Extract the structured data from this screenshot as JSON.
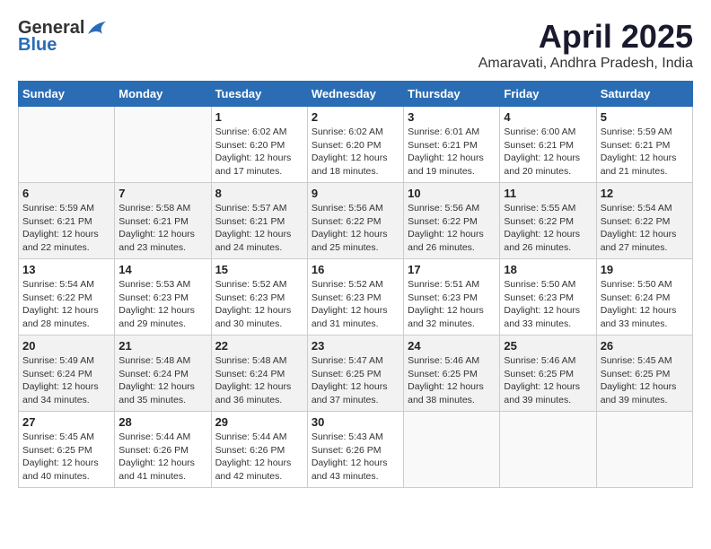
{
  "header": {
    "logo_general": "General",
    "logo_blue": "Blue",
    "title": "April 2025",
    "subtitle": "Amaravati, Andhra Pradesh, India"
  },
  "weekdays": [
    "Sunday",
    "Monday",
    "Tuesday",
    "Wednesday",
    "Thursday",
    "Friday",
    "Saturday"
  ],
  "weeks": [
    [
      {
        "day": "",
        "sunrise": "",
        "sunset": "",
        "daylight": ""
      },
      {
        "day": "",
        "sunrise": "",
        "sunset": "",
        "daylight": ""
      },
      {
        "day": "1",
        "sunrise": "Sunrise: 6:02 AM",
        "sunset": "Sunset: 6:20 PM",
        "daylight": "Daylight: 12 hours and 17 minutes."
      },
      {
        "day": "2",
        "sunrise": "Sunrise: 6:02 AM",
        "sunset": "Sunset: 6:20 PM",
        "daylight": "Daylight: 12 hours and 18 minutes."
      },
      {
        "day": "3",
        "sunrise": "Sunrise: 6:01 AM",
        "sunset": "Sunset: 6:21 PM",
        "daylight": "Daylight: 12 hours and 19 minutes."
      },
      {
        "day": "4",
        "sunrise": "Sunrise: 6:00 AM",
        "sunset": "Sunset: 6:21 PM",
        "daylight": "Daylight: 12 hours and 20 minutes."
      },
      {
        "day": "5",
        "sunrise": "Sunrise: 5:59 AM",
        "sunset": "Sunset: 6:21 PM",
        "daylight": "Daylight: 12 hours and 21 minutes."
      }
    ],
    [
      {
        "day": "6",
        "sunrise": "Sunrise: 5:59 AM",
        "sunset": "Sunset: 6:21 PM",
        "daylight": "Daylight: 12 hours and 22 minutes."
      },
      {
        "day": "7",
        "sunrise": "Sunrise: 5:58 AM",
        "sunset": "Sunset: 6:21 PM",
        "daylight": "Daylight: 12 hours and 23 minutes."
      },
      {
        "day": "8",
        "sunrise": "Sunrise: 5:57 AM",
        "sunset": "Sunset: 6:21 PM",
        "daylight": "Daylight: 12 hours and 24 minutes."
      },
      {
        "day": "9",
        "sunrise": "Sunrise: 5:56 AM",
        "sunset": "Sunset: 6:22 PM",
        "daylight": "Daylight: 12 hours and 25 minutes."
      },
      {
        "day": "10",
        "sunrise": "Sunrise: 5:56 AM",
        "sunset": "Sunset: 6:22 PM",
        "daylight": "Daylight: 12 hours and 26 minutes."
      },
      {
        "day": "11",
        "sunrise": "Sunrise: 5:55 AM",
        "sunset": "Sunset: 6:22 PM",
        "daylight": "Daylight: 12 hours and 26 minutes."
      },
      {
        "day": "12",
        "sunrise": "Sunrise: 5:54 AM",
        "sunset": "Sunset: 6:22 PM",
        "daylight": "Daylight: 12 hours and 27 minutes."
      }
    ],
    [
      {
        "day": "13",
        "sunrise": "Sunrise: 5:54 AM",
        "sunset": "Sunset: 6:22 PM",
        "daylight": "Daylight: 12 hours and 28 minutes."
      },
      {
        "day": "14",
        "sunrise": "Sunrise: 5:53 AM",
        "sunset": "Sunset: 6:23 PM",
        "daylight": "Daylight: 12 hours and 29 minutes."
      },
      {
        "day": "15",
        "sunrise": "Sunrise: 5:52 AM",
        "sunset": "Sunset: 6:23 PM",
        "daylight": "Daylight: 12 hours and 30 minutes."
      },
      {
        "day": "16",
        "sunrise": "Sunrise: 5:52 AM",
        "sunset": "Sunset: 6:23 PM",
        "daylight": "Daylight: 12 hours and 31 minutes."
      },
      {
        "day": "17",
        "sunrise": "Sunrise: 5:51 AM",
        "sunset": "Sunset: 6:23 PM",
        "daylight": "Daylight: 12 hours and 32 minutes."
      },
      {
        "day": "18",
        "sunrise": "Sunrise: 5:50 AM",
        "sunset": "Sunset: 6:23 PM",
        "daylight": "Daylight: 12 hours and 33 minutes."
      },
      {
        "day": "19",
        "sunrise": "Sunrise: 5:50 AM",
        "sunset": "Sunset: 6:24 PM",
        "daylight": "Daylight: 12 hours and 33 minutes."
      }
    ],
    [
      {
        "day": "20",
        "sunrise": "Sunrise: 5:49 AM",
        "sunset": "Sunset: 6:24 PM",
        "daylight": "Daylight: 12 hours and 34 minutes."
      },
      {
        "day": "21",
        "sunrise": "Sunrise: 5:48 AM",
        "sunset": "Sunset: 6:24 PM",
        "daylight": "Daylight: 12 hours and 35 minutes."
      },
      {
        "day": "22",
        "sunrise": "Sunrise: 5:48 AM",
        "sunset": "Sunset: 6:24 PM",
        "daylight": "Daylight: 12 hours and 36 minutes."
      },
      {
        "day": "23",
        "sunrise": "Sunrise: 5:47 AM",
        "sunset": "Sunset: 6:25 PM",
        "daylight": "Daylight: 12 hours and 37 minutes."
      },
      {
        "day": "24",
        "sunrise": "Sunrise: 5:46 AM",
        "sunset": "Sunset: 6:25 PM",
        "daylight": "Daylight: 12 hours and 38 minutes."
      },
      {
        "day": "25",
        "sunrise": "Sunrise: 5:46 AM",
        "sunset": "Sunset: 6:25 PM",
        "daylight": "Daylight: 12 hours and 39 minutes."
      },
      {
        "day": "26",
        "sunrise": "Sunrise: 5:45 AM",
        "sunset": "Sunset: 6:25 PM",
        "daylight": "Daylight: 12 hours and 39 minutes."
      }
    ],
    [
      {
        "day": "27",
        "sunrise": "Sunrise: 5:45 AM",
        "sunset": "Sunset: 6:25 PM",
        "daylight": "Daylight: 12 hours and 40 minutes."
      },
      {
        "day": "28",
        "sunrise": "Sunrise: 5:44 AM",
        "sunset": "Sunset: 6:26 PM",
        "daylight": "Daylight: 12 hours and 41 minutes."
      },
      {
        "day": "29",
        "sunrise": "Sunrise: 5:44 AM",
        "sunset": "Sunset: 6:26 PM",
        "daylight": "Daylight: 12 hours and 42 minutes."
      },
      {
        "day": "30",
        "sunrise": "Sunrise: 5:43 AM",
        "sunset": "Sunset: 6:26 PM",
        "daylight": "Daylight: 12 hours and 43 minutes."
      },
      {
        "day": "",
        "sunrise": "",
        "sunset": "",
        "daylight": ""
      },
      {
        "day": "",
        "sunrise": "",
        "sunset": "",
        "daylight": ""
      },
      {
        "day": "",
        "sunrise": "",
        "sunset": "",
        "daylight": ""
      }
    ]
  ]
}
